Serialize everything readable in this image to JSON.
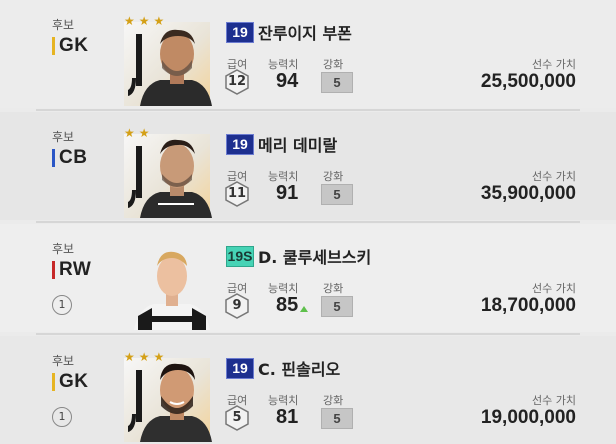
{
  "labels": {
    "sub": "후보",
    "salary": "급여",
    "ovr": "능력치",
    "enhance": "강화",
    "value": "선수 가치"
  },
  "colors": {
    "gk": "#e6b422",
    "cb": "#2a56c6",
    "rw": "#c62828"
  },
  "players": [
    {
      "status": "후보",
      "position": "GK",
      "season": "19",
      "name": "잔루이지 부폰",
      "salary": "12",
      "ovr": "94",
      "enhance": "5",
      "value": "25,500,000",
      "stars": "★★★"
    },
    {
      "status": "후보",
      "position": "CB",
      "season": "19",
      "name": "메리 데미랄",
      "salary": "11",
      "ovr": "91",
      "enhance": "5",
      "value": "35,900,000",
      "stars": "★★"
    },
    {
      "status": "후보",
      "position": "RW",
      "season": "19S",
      "name": "D. 쿨루세브스키",
      "salary": "9",
      "ovr": "85",
      "enhance": "5",
      "value": "18,700,000",
      "lock": "1"
    },
    {
      "status": "후보",
      "position": "GK",
      "season": "19",
      "name": "C. 핀솔리오",
      "salary": "5",
      "ovr": "81",
      "enhance": "5",
      "value": "19,000,000",
      "lock": "1",
      "stars": "★★★"
    }
  ]
}
